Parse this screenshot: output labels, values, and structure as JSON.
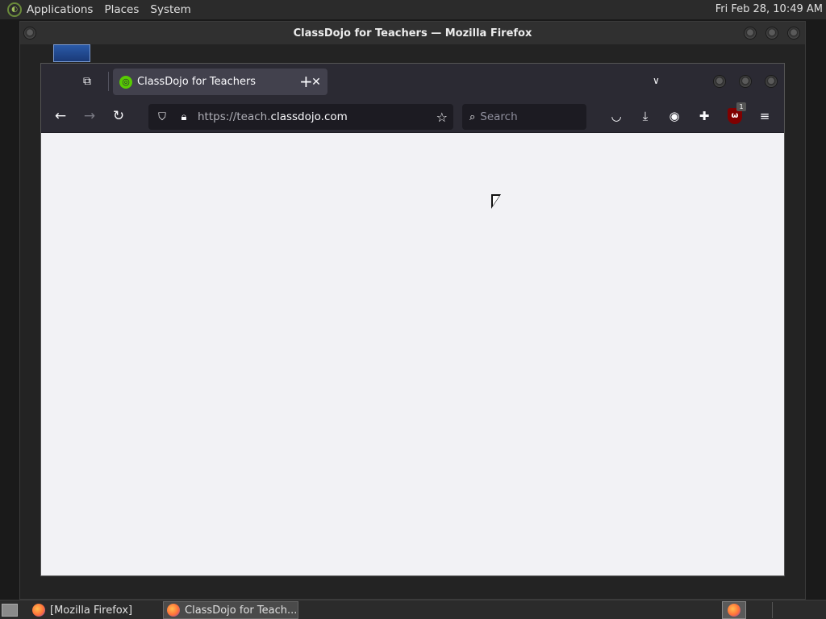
{
  "top_panel": {
    "menus": [
      "Applications",
      "Places",
      "System"
    ],
    "clock": "Fri Feb 28, 10:49 AM"
  },
  "outer_window": {
    "title": "ClassDojo for Teachers — Mozilla Firefox"
  },
  "firefox": {
    "tab": {
      "title": "ClassDojo for Teachers",
      "favicon": "classdojo-icon"
    },
    "url": {
      "prefix": "https://teach.",
      "domain": "classdojo.com"
    },
    "search": {
      "placeholder": "Search"
    },
    "ublock_badge": "1"
  },
  "taskbar": {
    "items": [
      "[Mozilla Firefox]",
      "ClassDojo for Teach..."
    ]
  }
}
